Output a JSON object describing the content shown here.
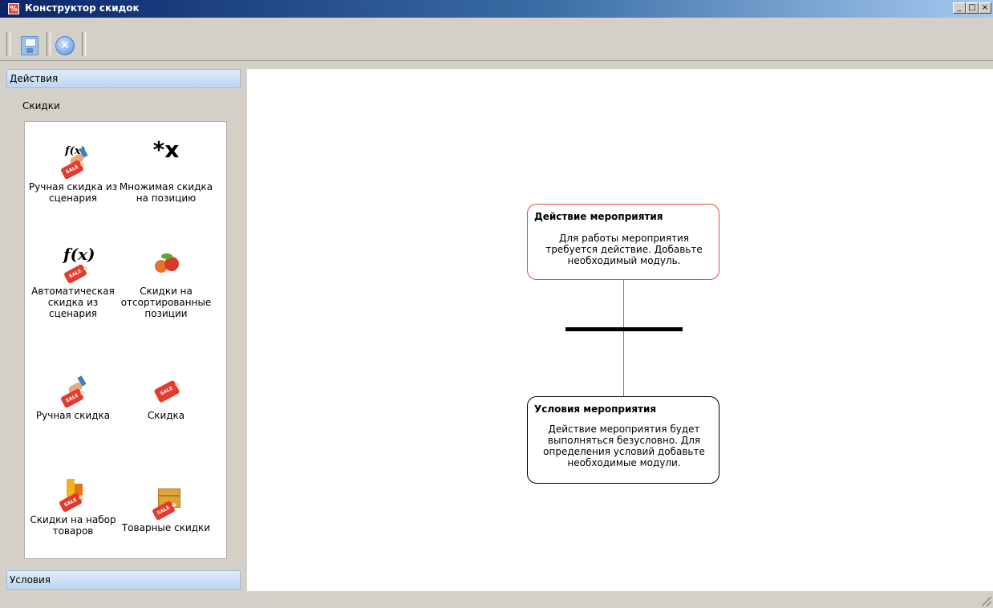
{
  "window": {
    "title": "Конструктор скидок",
    "app_icon": "%",
    "controls": {
      "minimize": "_",
      "maximize": "□",
      "close": "×"
    }
  },
  "toolbar": {
    "buttons": [
      {
        "name": "save",
        "icon": "save-disk-icon",
        "enabled": false
      },
      {
        "name": "cancel",
        "icon": "cancel-circle-icon",
        "glyph": "✕",
        "enabled": true
      }
    ]
  },
  "left_panel": {
    "actions_header": "Действия",
    "section_label": "Скидки",
    "tools": [
      {
        "label": "Ручная скидка из сценария",
        "icon": "fx-hand-sale-icon"
      },
      {
        "label": "Множимая скидка на позицию",
        "icon": "multiply-star-icon",
        "glyph": "*x"
      },
      {
        "label": "Автоматическая скидка из сценария",
        "icon": "fx-sale-tag-icon"
      },
      {
        "label": "Скидки на отсортированные позиции",
        "icon": "fruit-icon"
      },
      {
        "label": "Ручная скидка",
        "icon": "hand-sale-icon"
      },
      {
        "label": "Скидка",
        "icon": "sale-tag-icon"
      },
      {
        "label": "Скидки на набор товаров",
        "icon": "product-set-icon"
      },
      {
        "label": "Товарные скидки",
        "icon": "goods-box-icon"
      }
    ],
    "tag_text": "SALE",
    "fx_text": "f(x)",
    "conditions_header": "Условия"
  },
  "canvas": {
    "action_node": {
      "title": "Действие мероприятия",
      "description": "Для работы мероприятия требуется действие. Добавьте необходимый модуль.",
      "border_color": "#e8474a"
    },
    "condition_node": {
      "title": "Условия мероприятия",
      "description": "Действие мероприятия будет выполняться безусловно. Для определения условий добавьте необходимые модули.",
      "border_color": "#000000"
    }
  }
}
